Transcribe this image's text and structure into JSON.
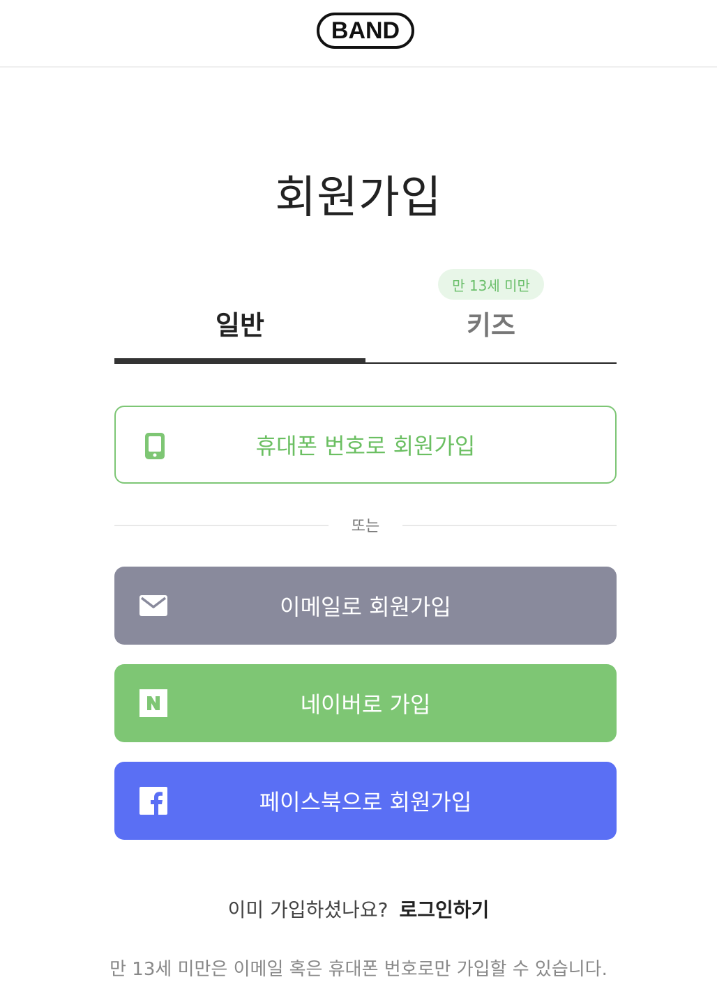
{
  "header": {
    "logo_text": "BAND"
  },
  "title": "회원가입",
  "tabs": {
    "general": "일반",
    "kids": "키즈",
    "kids_badge": "만 13세 미만"
  },
  "buttons": {
    "phone": "휴대폰 번호로 회원가입",
    "email": "이메일로 회원가입",
    "naver": "네이버로 가입",
    "facebook": "페이스북으로 회원가입"
  },
  "divider_text": "또는",
  "login_prompt": "이미 가입하셨나요?",
  "login_link": "로그인하기",
  "notice": "만 13세 미만은 이메일 혹은 휴대폰 번호로만 가입할 수 있습니다.",
  "colors": {
    "phone_green": "#6bbf62",
    "email_gray": "#898a9c",
    "naver_green": "#7ec674",
    "facebook_blue": "#5a6ff4"
  },
  "icons": {
    "phone": "phone-icon",
    "email": "mail-icon",
    "naver": "naver-icon",
    "facebook": "facebook-icon"
  }
}
